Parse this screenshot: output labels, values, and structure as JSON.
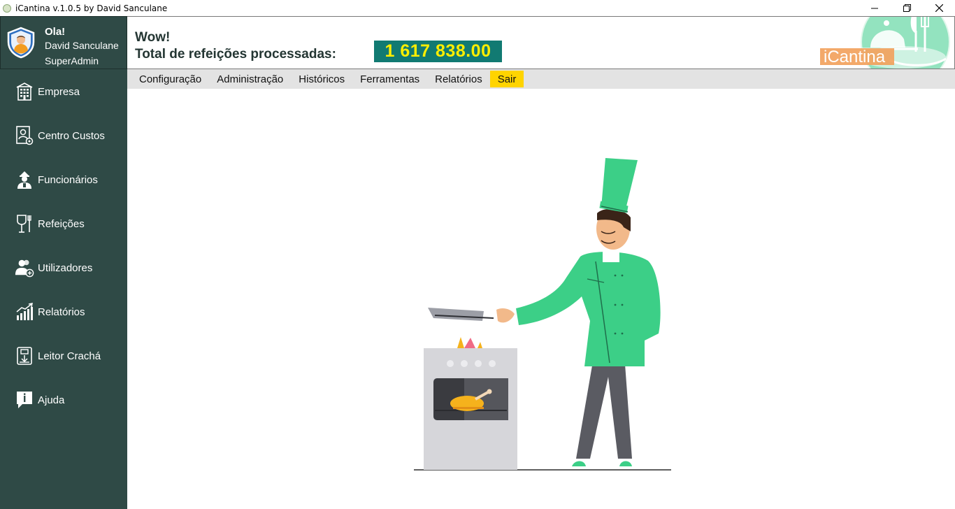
{
  "window": {
    "title": "iCantina v.1.0.5 by David Sanculane"
  },
  "user": {
    "greeting": "Ola!",
    "name": "David Sanculane",
    "role": "SuperAdmin"
  },
  "sidebar": {
    "items": [
      {
        "label": "Empresa",
        "icon": "building-icon"
      },
      {
        "label": "Centro Custos",
        "icon": "cost-center-icon"
      },
      {
        "label": "Funcionários",
        "icon": "employee-icon"
      },
      {
        "label": "Refeições",
        "icon": "meal-icon"
      },
      {
        "label": "Utilizadores",
        "icon": "users-icon"
      },
      {
        "label": "Relatórios",
        "icon": "chart-icon"
      },
      {
        "label": "Leitor Crachá",
        "icon": "badge-reader-icon"
      },
      {
        "label": "Ajuda",
        "icon": "help-icon"
      }
    ]
  },
  "header": {
    "wow": "Wow!",
    "total_label": "Total de refeições processadas:",
    "total_value": "1 617 838.00",
    "logo_text": "iCantina"
  },
  "menu": {
    "items": [
      "Configuração",
      "Administração",
      "Históricos",
      "Ferramentas",
      "Relatórios",
      "Sair"
    ]
  },
  "colors": {
    "sidebar": "#2f4a46",
    "counter_bg": "#117a72",
    "counter_text": "#ffee00",
    "accent_green": "#3ccf87",
    "exit_highlight": "#ffd400",
    "menubar": "#e3e3e3"
  }
}
